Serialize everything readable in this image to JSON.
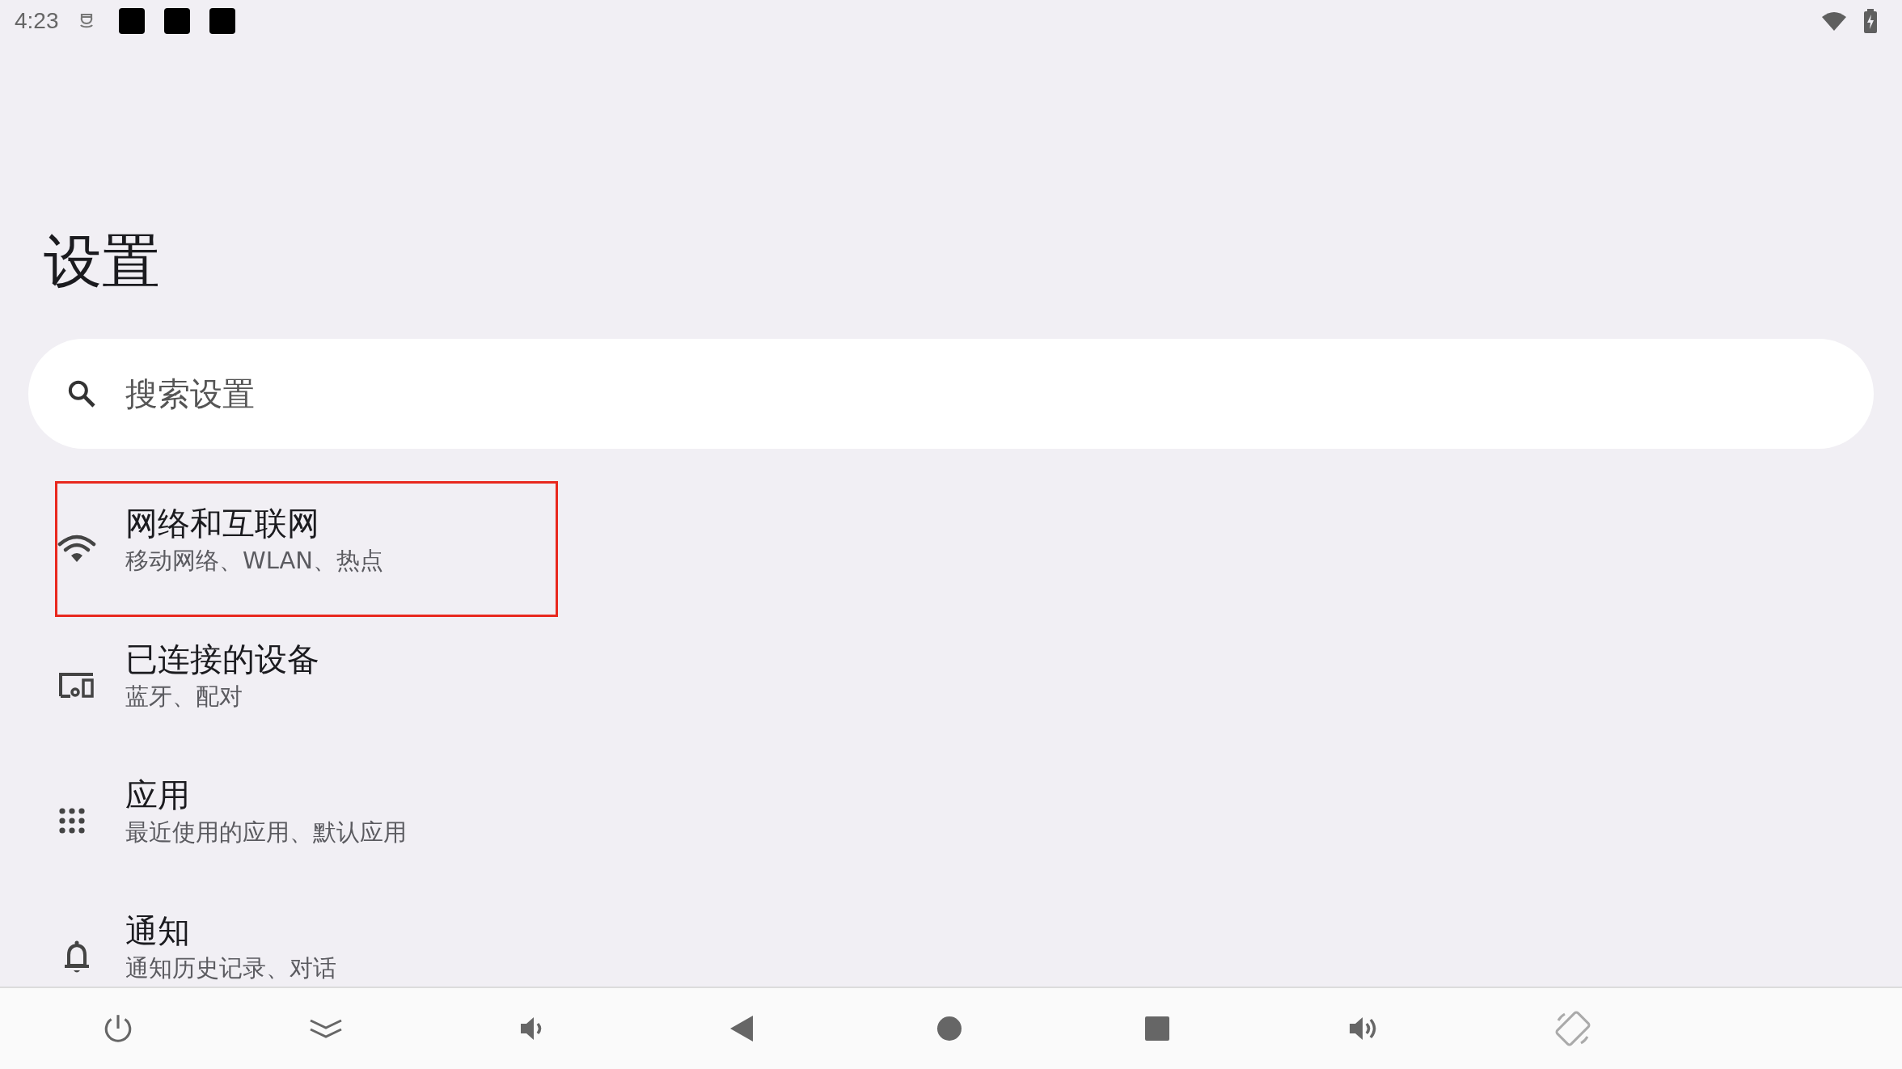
{
  "status_bar": {
    "time": "4:23"
  },
  "title": "设置",
  "search": {
    "placeholder": "搜索设置"
  },
  "items": [
    {
      "kind": "wifi",
      "title": "网络和互联网",
      "subtitle": "移动网络、WLAN、热点",
      "highlighted": true
    },
    {
      "kind": "devices",
      "title": "已连接的设备",
      "subtitle": "蓝牙、配对",
      "highlighted": false
    },
    {
      "kind": "apps",
      "title": "应用",
      "subtitle": "最近使用的应用、默认应用",
      "highlighted": false
    },
    {
      "kind": "bell",
      "title": "通知",
      "subtitle": "通知历史记录、对话",
      "highlighted": false
    }
  ],
  "nav_bar": [
    {
      "kind": "power"
    },
    {
      "kind": "collapse"
    },
    {
      "kind": "volume-down"
    },
    {
      "kind": "back"
    },
    {
      "kind": "home"
    },
    {
      "kind": "recents"
    },
    {
      "kind": "volume-up"
    },
    {
      "kind": "rotate"
    }
  ]
}
